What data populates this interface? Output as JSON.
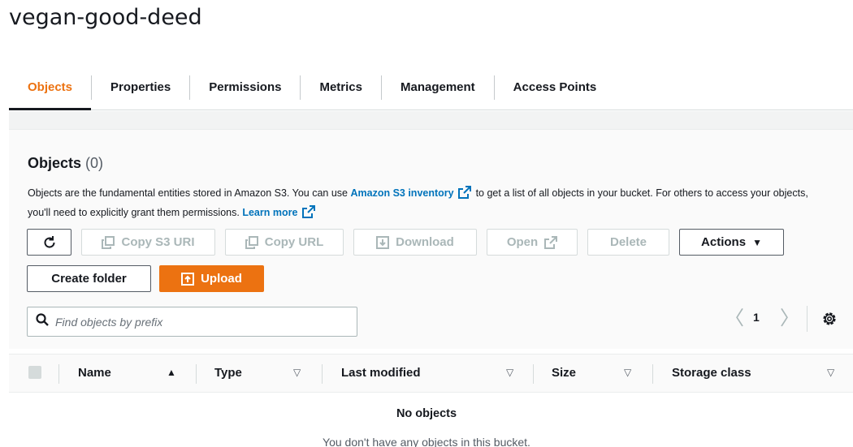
{
  "bucket": {
    "name": "vegan-good-deed"
  },
  "tabs": [
    {
      "label": "Objects",
      "active": true
    },
    {
      "label": "Properties"
    },
    {
      "label": "Permissions"
    },
    {
      "label": "Metrics"
    },
    {
      "label": "Management"
    },
    {
      "label": "Access Points"
    }
  ],
  "objects_panel": {
    "heading": "Objects",
    "count": "(0)",
    "desc_part1": "Objects are the fundamental entities stored in Amazon S3. You can use ",
    "inventory_link": "Amazon S3 inventory",
    "desc_part2": " to get a list of all objects in your bucket. For others to access your objects, you'll need to explicitly grant them permissions. ",
    "learn_more_link": "Learn more"
  },
  "toolbar": {
    "copy_s3_uri": "Copy S3 URI",
    "copy_url": "Copy URL",
    "download": "Download",
    "open": "Open",
    "delete": "Delete",
    "actions": "Actions",
    "create_folder": "Create folder",
    "upload": "Upload"
  },
  "search": {
    "placeholder": "Find objects by prefix"
  },
  "pagination": {
    "current_page": "1"
  },
  "table": {
    "columns": [
      "Name",
      "Type",
      "Last modified",
      "Size",
      "Storage class"
    ],
    "empty_title": "No objects",
    "empty_text": "You don't have any objects in this bucket."
  },
  "colors": {
    "accent": "#ec7211",
    "link": "#0073bb",
    "text": "#16191f",
    "disabled": "#aab7b8"
  }
}
